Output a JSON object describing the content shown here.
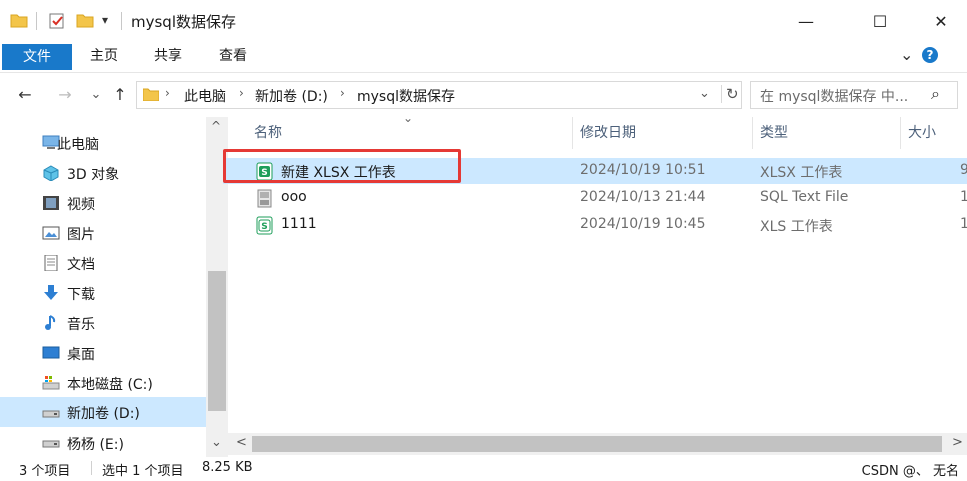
{
  "window": {
    "title": "mysql数据保存",
    "minimize_glyph": "—",
    "maximize_glyph": "☐",
    "close_glyph": "✕",
    "qat_dropdown_glyph": "▾"
  },
  "ribbon": {
    "tabs": [
      {
        "label": "文件",
        "active": true
      },
      {
        "label": "主页",
        "active": false
      },
      {
        "label": "共享",
        "active": false
      },
      {
        "label": "查看",
        "active": false
      }
    ],
    "expand_glyph": "⌄",
    "help_glyph": "?"
  },
  "address": {
    "back_glyph": "←",
    "forward_glyph": "→",
    "recent_glyph": "⌄",
    "up_glyph": "↑",
    "breadcrumbs": [
      "此电脑",
      "新加卷 (D:)",
      "mysql数据保存"
    ],
    "separator_glyph": "›",
    "dropdown_glyph": "⌄",
    "refresh_glyph": "↻",
    "search_placeholder": "在 mysql数据保存 中...",
    "search_icon_glyph": "⌕"
  },
  "sidebar": {
    "items": [
      {
        "label": "此电脑",
        "icon": "computer-icon",
        "selected": false
      },
      {
        "label": "3D 对象",
        "icon": "3d-objects-icon",
        "selected": false
      },
      {
        "label": "视频",
        "icon": "video-icon",
        "selected": false
      },
      {
        "label": "图片",
        "icon": "pictures-icon",
        "selected": false
      },
      {
        "label": "文档",
        "icon": "documents-icon",
        "selected": false
      },
      {
        "label": "下载",
        "icon": "download-icon",
        "selected": false
      },
      {
        "label": "音乐",
        "icon": "music-icon",
        "selected": false
      },
      {
        "label": "桌面",
        "icon": "desktop-icon",
        "selected": false
      },
      {
        "label": "本地磁盘 (C:)",
        "icon": "local-disk-icon",
        "selected": false
      },
      {
        "label": "新加卷 (D:)",
        "icon": "drive-icon",
        "selected": true
      },
      {
        "label": "杨杨 (E:)",
        "icon": "drive-icon",
        "selected": false
      }
    ],
    "scroll_up_glyph": "^",
    "scroll_down_glyph": "⌄"
  },
  "columns": {
    "name": "名称",
    "date": "修改日期",
    "type": "类型",
    "size": "大小",
    "sort_glyph": "⌄"
  },
  "files": [
    {
      "name": "新建 XLSX 工作表",
      "date": "2024/10/19 10:51",
      "type": "XLSX 工作表",
      "size": "9",
      "icon": "xlsx-file-icon",
      "selected": true
    },
    {
      "name": "ooo",
      "date": "2024/10/13 21:44",
      "type": "SQL Text File",
      "size": "1",
      "icon": "sql-file-icon",
      "selected": false
    },
    {
      "name": "1111",
      "date": "2024/10/19 10:45",
      "type": "XLS 工作表",
      "size": "1",
      "icon": "xls-file-icon",
      "selected": false
    }
  ],
  "hscroll": {
    "left_glyph": "<",
    "right_glyph": ">"
  },
  "status": {
    "item_count": "3 个项目",
    "selection": "选中 1 个项目",
    "selection_size": "8.25 KB",
    "watermark": "CSDN @、 无名"
  },
  "colors": {
    "accent": "#1979ca",
    "selection": "#cce8ff",
    "highlight_box": "#e53935"
  }
}
